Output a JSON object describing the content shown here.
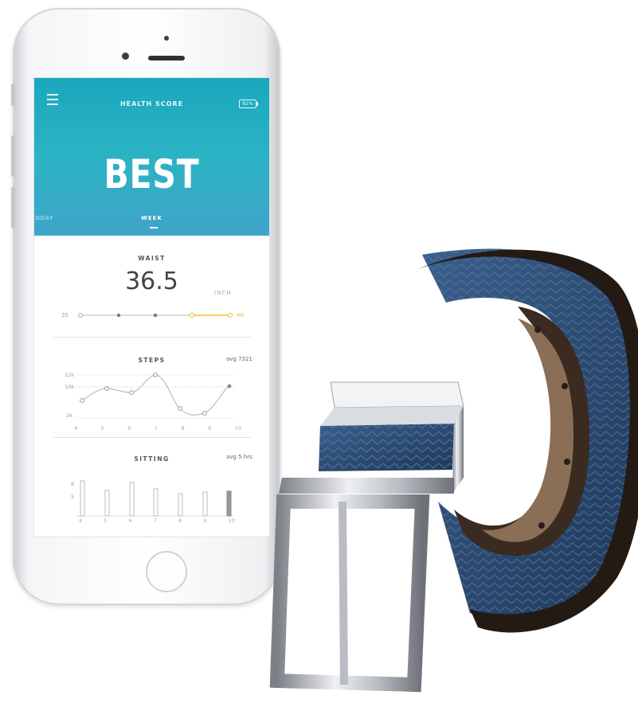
{
  "app": {
    "header_title": "HEALTH SCORE",
    "battery": "81%",
    "score": "BEST",
    "tabs": [
      "TODAY",
      "WEEK"
    ]
  },
  "waist": {
    "title": "WAIST",
    "value": "36.5",
    "unit": "INCH",
    "range_min": "35",
    "range_max": "40"
  },
  "steps": {
    "title": "STEPS",
    "avg": "avg 7321",
    "y_labels": [
      "12k",
      "10k",
      "2k"
    ],
    "x_labels": [
      "4",
      "5",
      "6",
      "7",
      "8",
      "9",
      "10"
    ]
  },
  "sitting": {
    "title": "SITTING",
    "avg": "avg 5 hrs",
    "y_labels": [
      "8",
      "5"
    ],
    "x_labels": [
      "4",
      "5",
      "6",
      "7",
      "8",
      "9",
      "10"
    ]
  },
  "colors": {
    "header_teal": "#1ba7bd",
    "accent_yellow": "#f0c232",
    "belt_blue": "#2d4f7a"
  },
  "icons": [
    "menu-icon",
    "battery-icon"
  ]
}
